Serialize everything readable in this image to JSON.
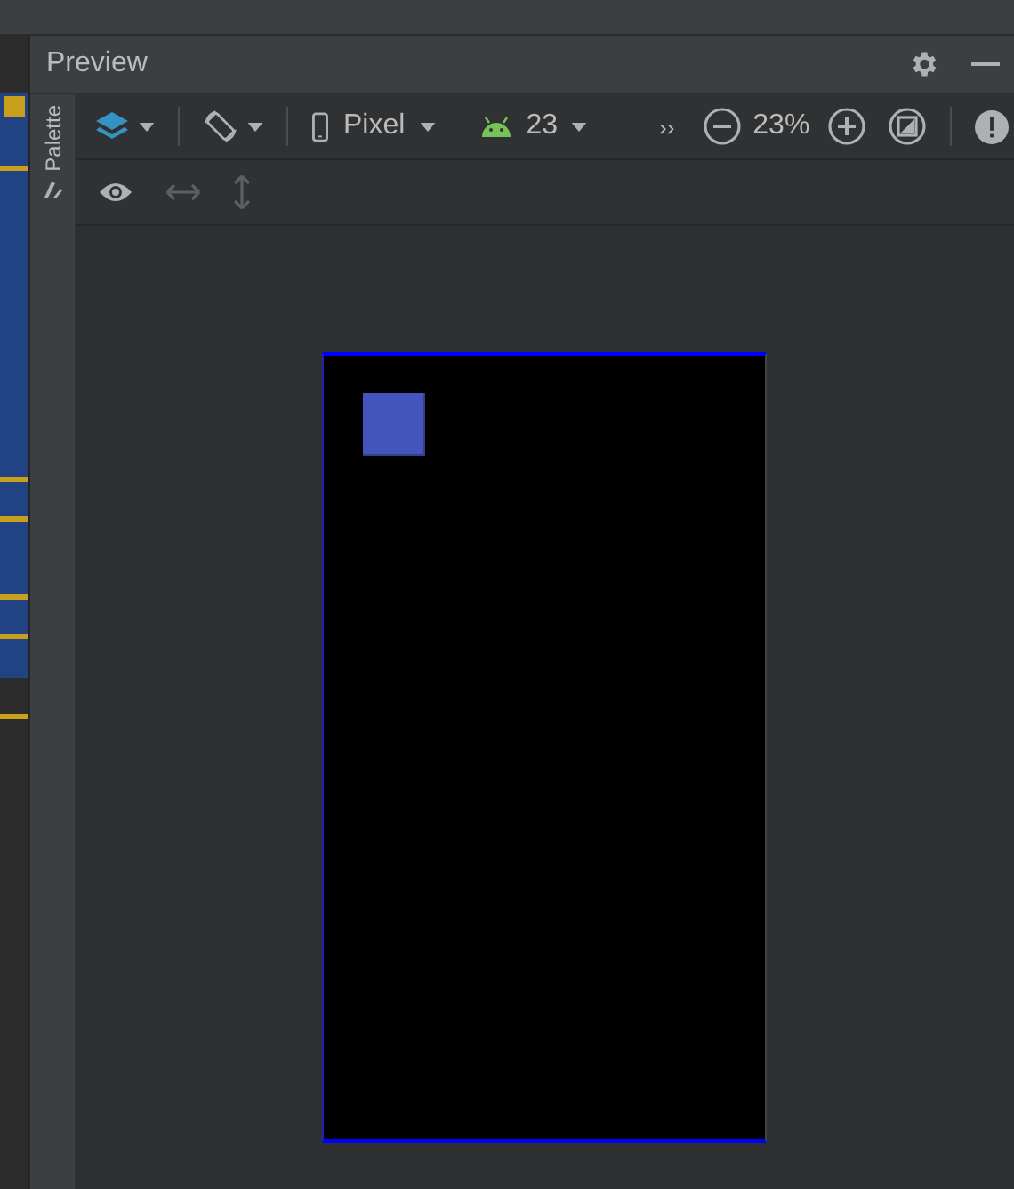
{
  "panel": {
    "title": "Preview"
  },
  "palette": {
    "label": "Palette"
  },
  "toolbar": {
    "device": "Pixel",
    "api_level": "23",
    "overflow": "››",
    "zoom": "23%"
  },
  "view_toolbar": [
    {
      "kind": "eye",
      "disabled": false
    },
    {
      "kind": "horizontal",
      "disabled": true
    },
    {
      "kind": "vertical",
      "disabled": true
    }
  ]
}
